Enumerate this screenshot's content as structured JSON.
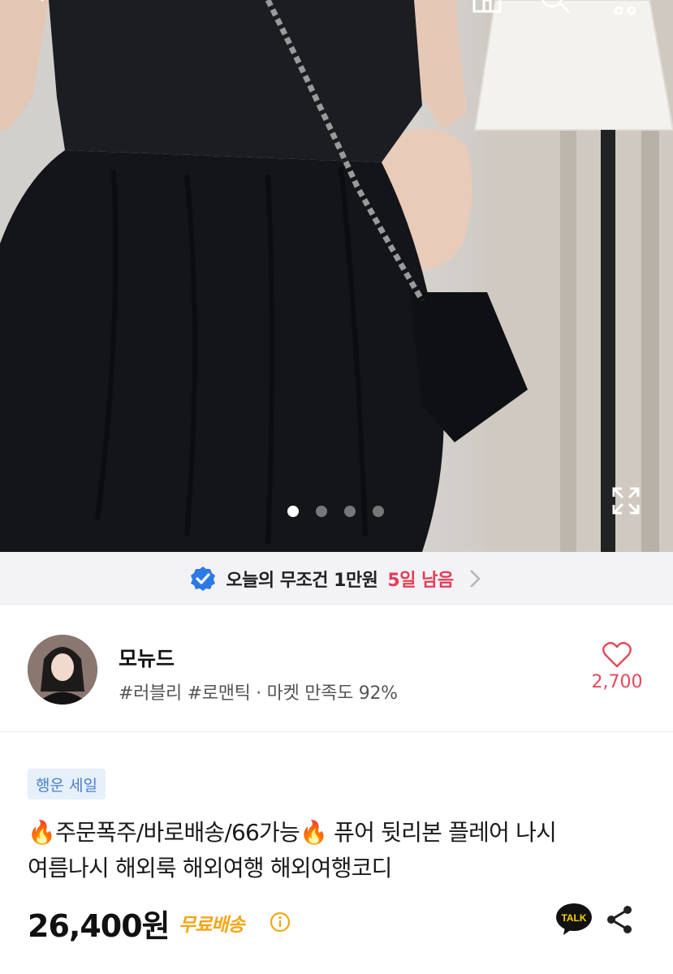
{
  "topbar": {
    "icons": [
      "back-icon",
      "home-icon",
      "search-icon",
      "cart-icon"
    ]
  },
  "gallery": {
    "slide_count": 4,
    "active_index": 0
  },
  "banner": {
    "text": "오늘의 무조건 1만원",
    "count": "5일 남음",
    "accent": "#ea3a56",
    "badge_color": "#2c7be5"
  },
  "shop": {
    "name": "모뉴드",
    "tags": "#러블리 #로맨틱 · 마켓 만족도 92%",
    "like_count": "2,700"
  },
  "product": {
    "badge": "행운 세일",
    "title_line1": "주문폭주/바로배송/66가능",
    "title_line1b": " 퓨어 뒷리본 플레어 나시",
    "title_line2": "여름나시 해외룩 해외여행 해외여행코디",
    "fire_emoji": "🔥",
    "price": "26,400원",
    "shipping": "무료배송",
    "talk_label": "TALK"
  }
}
